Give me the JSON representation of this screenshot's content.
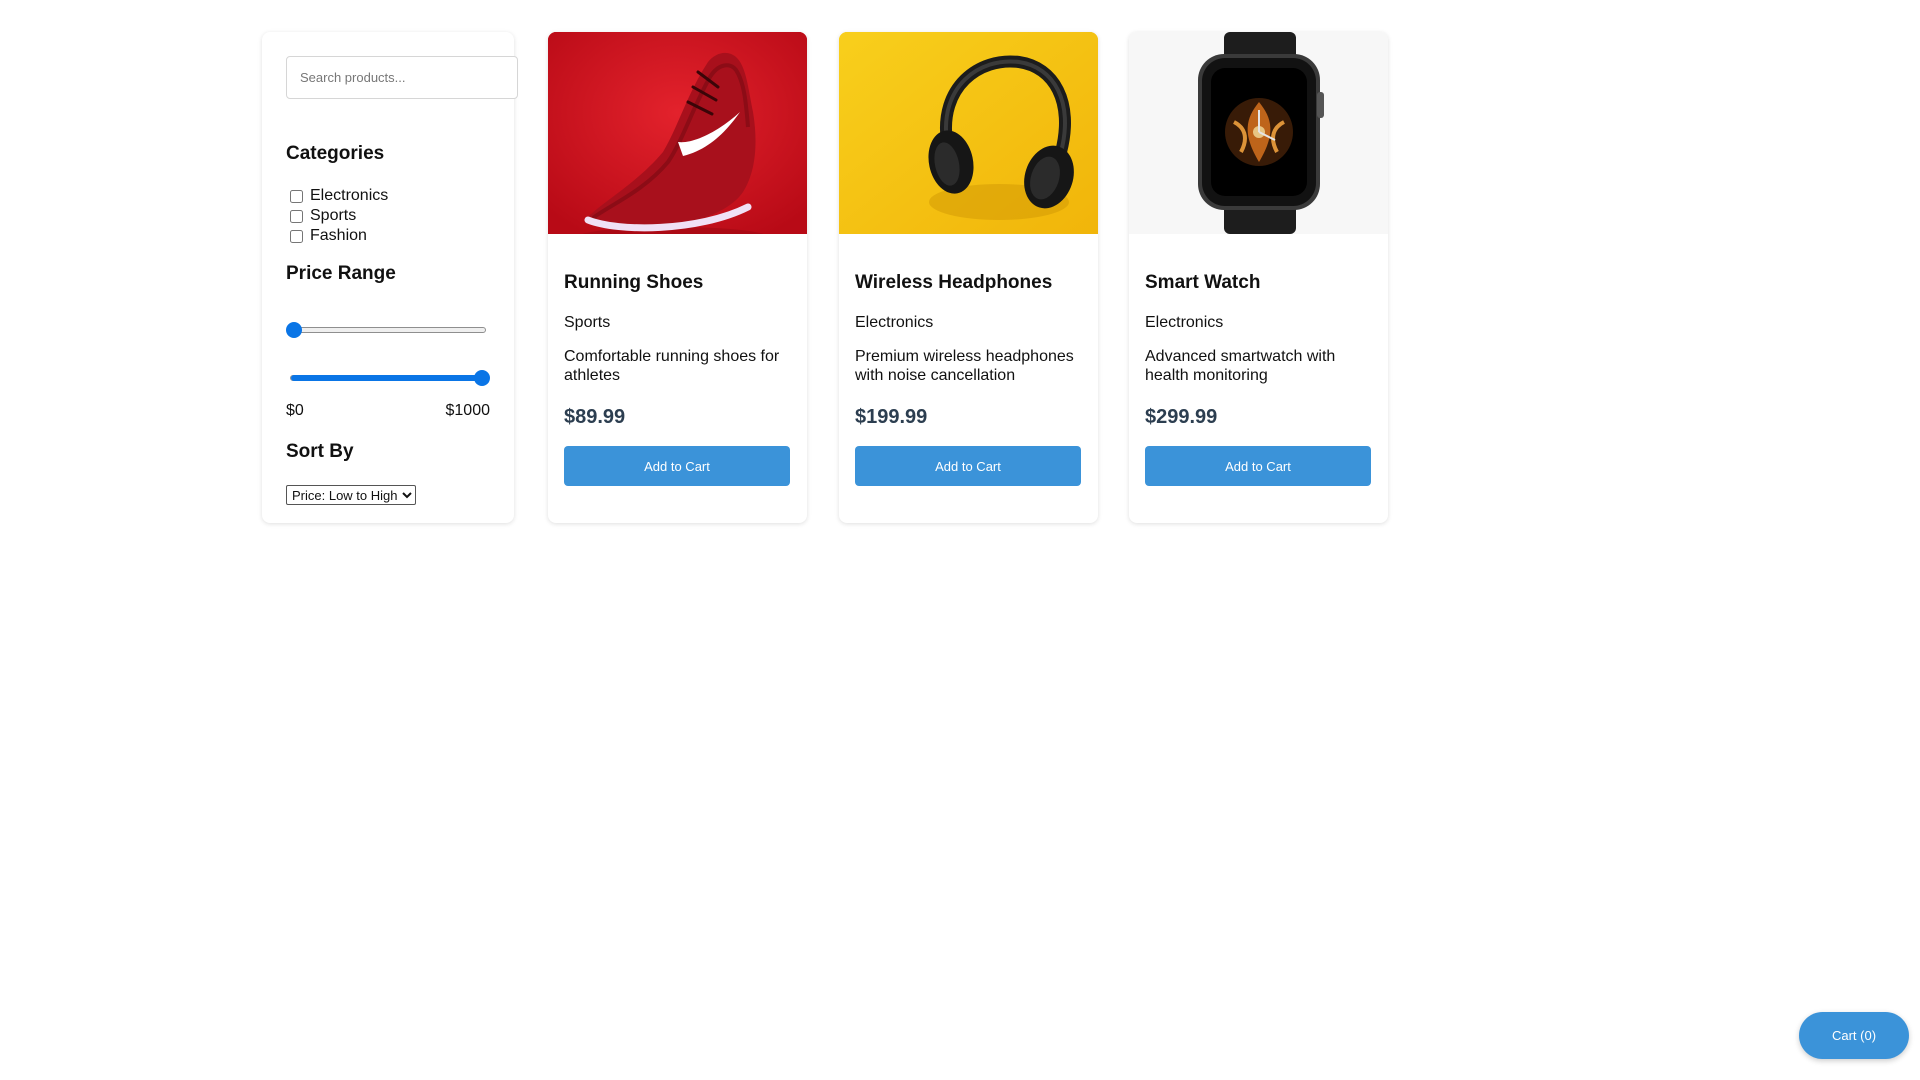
{
  "search": {
    "placeholder": "Search products..."
  },
  "filters": {
    "categories_heading": "Categories",
    "categories": [
      {
        "label": "Electronics",
        "checked": false
      },
      {
        "label": "Sports",
        "checked": false
      },
      {
        "label": "Fashion",
        "checked": false
      }
    ],
    "price_heading": "Price Range",
    "price_min": {
      "value": 0,
      "max": 1000
    },
    "price_max": {
      "value": 1000,
      "max": 1000
    },
    "price_min_label": "$0",
    "price_max_label": "$1000",
    "sort_heading": "Sort By",
    "sort_selected": "Price: Low to High"
  },
  "products": [
    {
      "name": "Running Shoes",
      "category": "Sports",
      "description": "Comfortable running shoes for athletes",
      "price": "$89.99",
      "button": "Add to Cart",
      "image_icon": "running-shoe-icon",
      "image_bg": "#d0101e"
    },
    {
      "name": "Wireless Headphones",
      "category": "Electronics",
      "description": "Premium wireless headphones with noise cancellation",
      "price": "$199.99",
      "button": "Add to Cart",
      "image_icon": "headphones-icon",
      "image_bg": "#f5c214"
    },
    {
      "name": "Smart Watch",
      "category": "Electronics",
      "description": "Advanced smartwatch with health monitoring",
      "price": "$299.99",
      "button": "Add to Cart",
      "image_icon": "smartwatch-icon",
      "image_bg": "#f7f7f7"
    }
  ],
  "cart": {
    "label": "Cart (0)"
  },
  "colors": {
    "accent": "#3b93d9",
    "slider": "#0a75e6",
    "price_text": "#2c3e50"
  }
}
